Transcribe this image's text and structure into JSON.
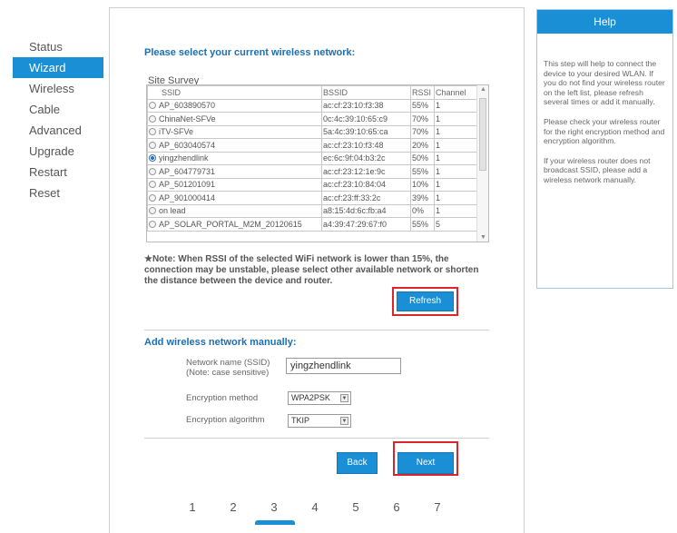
{
  "nav": {
    "items": [
      {
        "label": "Status",
        "active": false
      },
      {
        "label": "Wizard",
        "active": true
      },
      {
        "label": "Wireless",
        "active": false
      },
      {
        "label": "Cable",
        "active": false
      },
      {
        "label": "Advanced",
        "active": false
      },
      {
        "label": "Upgrade",
        "active": false
      },
      {
        "label": "Restart",
        "active": false
      },
      {
        "label": "Reset",
        "active": false
      }
    ]
  },
  "main": {
    "title": "Please select your current wireless network:",
    "site_survey": "Site Survey",
    "columns": [
      "SSID",
      "BSSID",
      "RSSI",
      "Channel"
    ],
    "rows": [
      {
        "ssid": "AP_603890570",
        "bssid": "ac:cf:23:10:f3:38",
        "rssi": "55%",
        "channel": "1",
        "selected": false
      },
      {
        "ssid": "ChinaNet-SFVe",
        "bssid": "0c:4c:39:10:65:c9",
        "rssi": "70%",
        "channel": "1",
        "selected": false
      },
      {
        "ssid": "iTV-SFVe",
        "bssid": "5a:4c:39:10:65:ca",
        "rssi": "70%",
        "channel": "1",
        "selected": false
      },
      {
        "ssid": "AP_603040574",
        "bssid": "ac:cf:23:10:f3:48",
        "rssi": "20%",
        "channel": "1",
        "selected": false
      },
      {
        "ssid": "yingzhendlink",
        "bssid": "ec:6c:9f:04:b3:2c",
        "rssi": "50%",
        "channel": "1",
        "selected": true
      },
      {
        "ssid": "AP_604779731",
        "bssid": "ac:cf:23:12:1e:9c",
        "rssi": "55%",
        "channel": "1",
        "selected": false
      },
      {
        "ssid": "AP_501201091",
        "bssid": "ac:cf:23:10:84:04",
        "rssi": "10%",
        "channel": "1",
        "selected": false
      },
      {
        "ssid": "AP_901000414",
        "bssid": "ac:cf:23:ff:33:2c",
        "rssi": "39%",
        "channel": "1",
        "selected": false
      },
      {
        "ssid": "on lead",
        "bssid": "a8:15:4d:6c:fb:a4",
        "rssi": "0%",
        "channel": "1",
        "selected": false
      },
      {
        "ssid": "AP_SOLAR_PORTAL_M2M_20120615",
        "bssid": "a4:39:47:29:67:f0",
        "rssi": "55%",
        "channel": "5",
        "selected": false
      }
    ],
    "note": "★Note: When RSSI of the selected WiFi network is lower than 15%, the connection may be unstable, please select other available network or shorten the distance between the device and router.",
    "refresh_label": "Refresh",
    "manual_title": "Add wireless network manually:",
    "ssid_label_line1": "Network name (SSID)",
    "ssid_label_line2": "(Note: case sensitive)",
    "ssid_value": "yingzhendlink",
    "encryption_method_label": "Encryption method",
    "encryption_method_value": "WPA2PSK",
    "encryption_algorithm_label": "Encryption algorithm",
    "encryption_algorithm_value": "TKIP",
    "back_label": "Back",
    "next_label": "Next",
    "steps": [
      "1",
      "2",
      "3",
      "4",
      "5",
      "6",
      "7"
    ],
    "current_step": "3"
  },
  "help": {
    "title": "Help",
    "paragraphs": [
      "This step will help to connect the device to your desired WLAN. If you do not find your wireless router on the left list, please refresh several times or add it manually.",
      "Please check your wireless router for the right encryption method and encryption algorithm.",
      "If your wireless router does not broadcast SSID, please add a wireless network manually."
    ]
  },
  "colors": {
    "accent": "#1a8fd6",
    "highlight_box": "#d9262c",
    "title_blue": "#1c6fb4"
  }
}
